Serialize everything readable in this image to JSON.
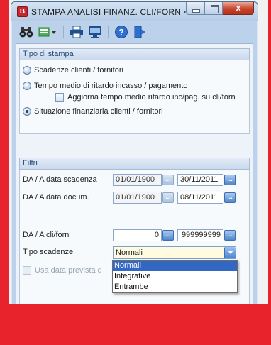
{
  "window": {
    "title": "STAMPA ANALISI FINANZ. CLI/FORN <...",
    "app_icon_letter": "B",
    "close_glyph": "x"
  },
  "toolbar": {
    "icons": [
      "binoculars-icon",
      "list-view-icon",
      "printer-icon",
      "monitor-preview-icon",
      "help-icon",
      "exit-door-icon"
    ]
  },
  "print_type": {
    "header": "Tipo di stampa",
    "option_scadenze": "Scadenze clienti / fornitori",
    "option_tempo_medio": "Tempo medio di ritardo incasso / pagamento",
    "checkbox_aggiorna": "Aggiorna tempo medio ritardo inc/pag. su cli/forn",
    "option_situazione": "Situazione finanziaria clienti / fornitori",
    "selected": "situazione"
  },
  "filters": {
    "header": "Filtri",
    "scadenza_label": "DA / A data scadenza",
    "scadenza_from": "01/01/1900",
    "scadenza_to": "30/11/2011",
    "documento_label": "DA / A data docum.",
    "documento_from": "01/01/1900",
    "documento_to": "08/11/2011",
    "cliforn_label": "DA / A cli/forn",
    "cliforn_from": "0",
    "cliforn_to": "999999999",
    "tipo_label": "Tipo scadenze",
    "tipo_value": "Normali",
    "tipo_options": [
      "Normali",
      "Integrative",
      "Entrambe"
    ],
    "usa_data_label": "Usa data prevista d",
    "dots": "..."
  },
  "colors": {
    "background_red": "#e8232b",
    "selection_blue": "#3367c4",
    "group_header_text": "#2b4a78"
  }
}
